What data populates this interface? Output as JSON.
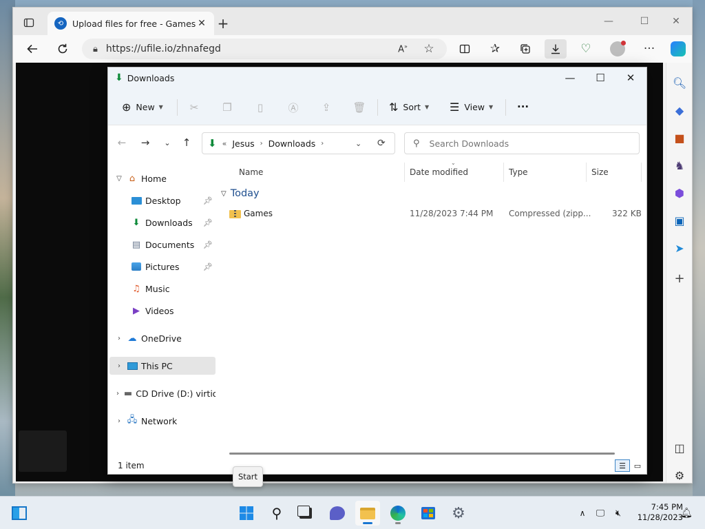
{
  "browser": {
    "tab_title": "Upload files for free - Games.zip",
    "tab_close": "✕",
    "new_tab": "+",
    "url": "https://ufile.io/zhnafegd",
    "min": "—",
    "max": "☐",
    "close": "✕"
  },
  "explorer": {
    "title": "Downloads",
    "cmd": {
      "new_label": "New",
      "sort_label": "Sort",
      "view_label": "View",
      "more_label": "···"
    },
    "breadcrumb": {
      "overflow": "«",
      "items": [
        "Jesus",
        "Downloads"
      ]
    },
    "search_placeholder": "Search Downloads",
    "nav": {
      "home": "Home",
      "quick": [
        {
          "label": "Desktop"
        },
        {
          "label": "Downloads"
        },
        {
          "label": "Documents"
        },
        {
          "label": "Pictures"
        },
        {
          "label": "Music"
        },
        {
          "label": "Videos"
        }
      ],
      "onedrive": "OneDrive",
      "thispc": "This PC",
      "cddrive": "CD Drive (D:) virtio-win",
      "network": "Network"
    },
    "columns": {
      "name": "Name",
      "date": "Date modified",
      "type": "Type",
      "size": "Size"
    },
    "group": "Today",
    "files": [
      {
        "name": "Games",
        "date": "11/28/2023 7:44 PM",
        "type": "Compressed (zipp...",
        "size": "322 KB"
      }
    ],
    "status": "1 item"
  },
  "tooltip": "Start",
  "taskbar": {
    "time": "7:45 PM",
    "date": "11/28/2023"
  },
  "colors": {
    "accent": "#0078d4",
    "folder": "#f2c14e",
    "download_green": "#0e8a3a"
  }
}
